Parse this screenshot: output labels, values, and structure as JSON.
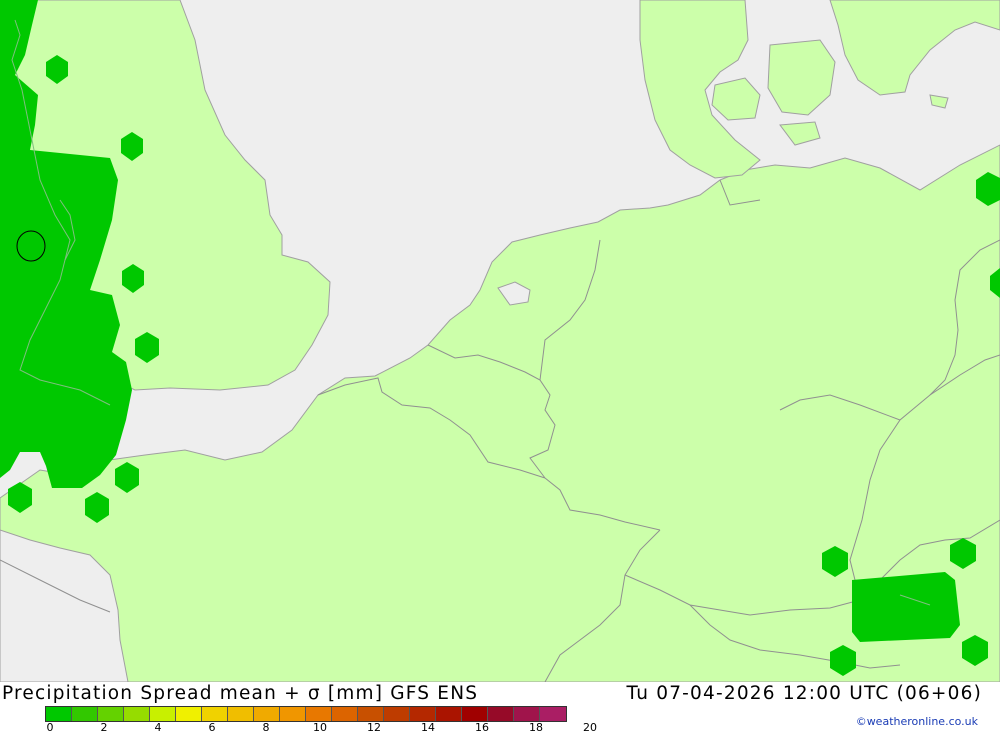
{
  "header": {
    "product_title": "Precipitation Spread mean + σ [mm] GFS ENS",
    "valid_time": "Tu 07-04-2026 12:00 UTC (06+06)"
  },
  "legend": {
    "tick_labels": [
      "0",
      "2",
      "4",
      "6",
      "8",
      "10",
      "12",
      "14",
      "16",
      "18",
      "20"
    ],
    "colors": [
      "#00c800",
      "#32c800",
      "#64d200",
      "#96dc00",
      "#c8f000",
      "#f0f000",
      "#f0d200",
      "#f0be00",
      "#f0aa00",
      "#f09600",
      "#e87800",
      "#dc6400",
      "#c85000",
      "#be3c00",
      "#b42800",
      "#aa1400",
      "#a00000",
      "#960a28",
      "#a0144b",
      "#aa1e64"
    ]
  },
  "credit": "©weatheronline.co.uk",
  "map_colors": {
    "sea": "#eeeeee",
    "land": "#ccffaa",
    "precip_light": "#00c800",
    "coastline": "#a0a0a0",
    "border": "#909090"
  }
}
